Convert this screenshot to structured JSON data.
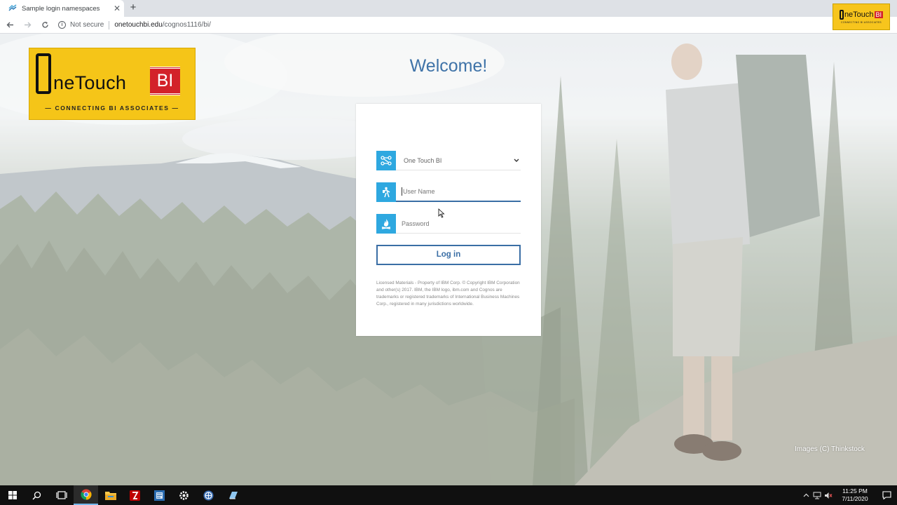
{
  "browser": {
    "tab_title": "Sample login namespaces",
    "tab_close": "✕",
    "new_tab": "+",
    "security_label": "Not secure",
    "url_host": "onetouchbi.edu",
    "url_path": "/cognos1116/bi/"
  },
  "corner_logo": {
    "main": "neTouch",
    "bi": "BI",
    "sub": "CONNECTING BI ASSOCIATES"
  },
  "brand": {
    "logo_text": "neTouch",
    "logo_bi": "BI",
    "tagline": "— CONNECTING BI ASSOCIATES —"
  },
  "login": {
    "welcome": "Welcome!",
    "namespace_value": "One Touch BI",
    "username_placeholder": "User Name",
    "password_placeholder": "Password",
    "login_button": "Log in",
    "legal_text": "Licensed Materials - Property of IBM Corp. © Copyright IBM Corporation and other(s) 2017. IBM, the IBM logo, ibm.com and Cognos are trademarks or registered trademarks of International Business Machines Corp., registered in many jurisdictions worldwide."
  },
  "image_credit": "Images (C) Thinkstock",
  "taskbar": {
    "time": "11:25 PM",
    "date": "7/11/2020",
    "items": [
      "start-icon",
      "search-icon",
      "task-view-icon",
      "chrome-icon",
      "file-explorer-icon",
      "filezilla-icon",
      "word-app-icon",
      "settings-icon",
      "network-app-icon",
      "remote-desktop-icon"
    ]
  },
  "colors": {
    "accent_blue": "#2ea8e0",
    "button_blue": "#3a6ea5",
    "welcome_blue": "#3f73a8",
    "logo_yellow": "#f5c518",
    "logo_red": "#d3222a"
  }
}
